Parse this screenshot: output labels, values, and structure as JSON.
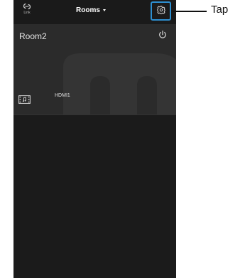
{
  "topbar": {
    "link_label": "Link",
    "title": "Rooms",
    "link_icon": "link-chain-icon",
    "settings_icon": "gear-icon",
    "dropdown_icon": "caret-down-icon"
  },
  "room": {
    "name": "Room2",
    "power_icon": "power-icon",
    "source_icon": "film-music-icon",
    "source_label": "HDMI1",
    "background_glyph_icon": "m-logo-watermark"
  },
  "annotation": {
    "label": "Tap",
    "highlight_color": "#2d8fd0"
  },
  "colors": {
    "app_background": "#1b1b1b",
    "card_background": "#2b2b2b",
    "text": "#e6e6e6"
  }
}
